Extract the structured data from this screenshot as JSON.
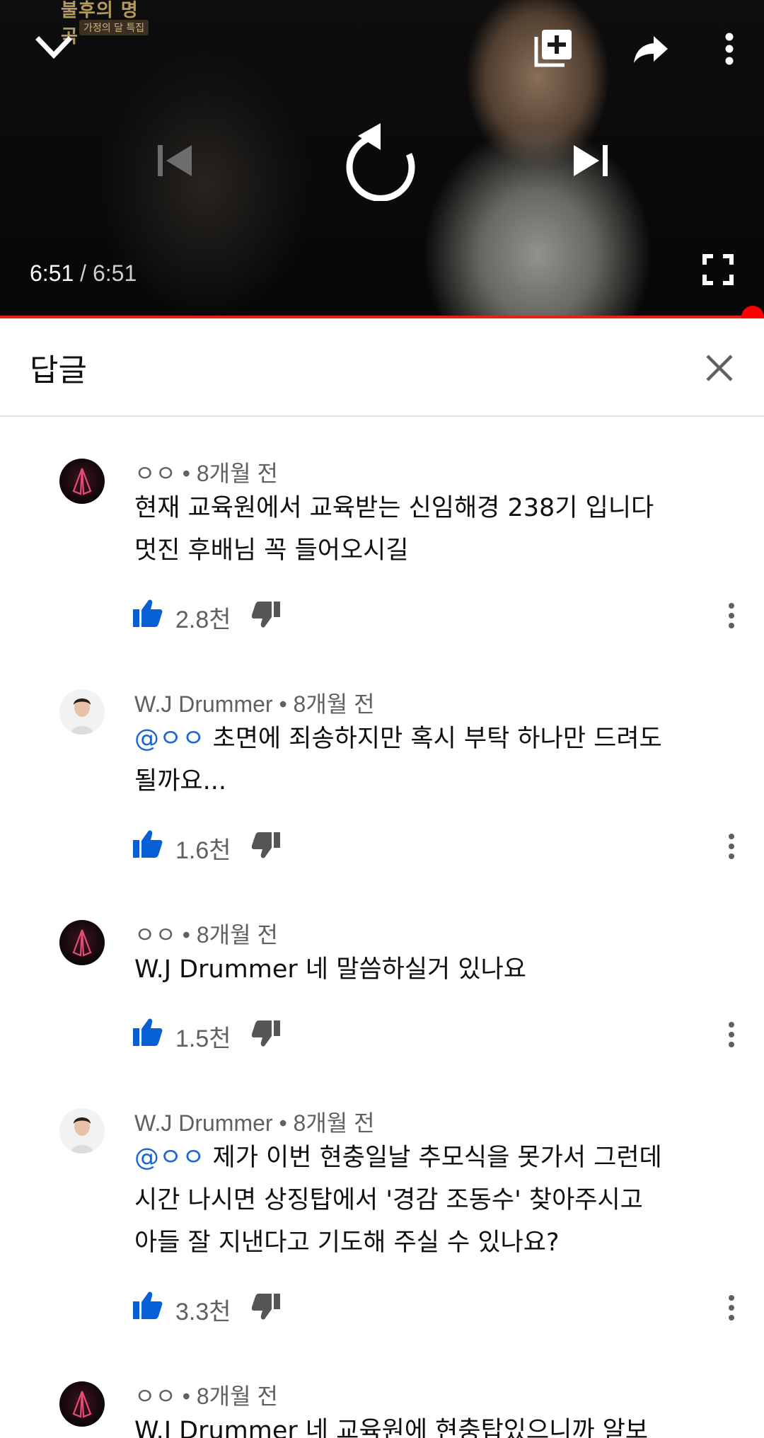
{
  "player": {
    "show_logo_text": "불후의 명곡",
    "show_logo_tag": "가정의 달 특집",
    "current_time": "6:51",
    "separator": "/",
    "duration": "6:51",
    "progress_fraction": 1.0,
    "icons": {
      "collapse": "chevron-down-icon",
      "add_to_queue": "add-to-queue-icon",
      "share": "share-icon",
      "more": "more-vert-icon",
      "previous": "skip-previous-icon",
      "replay": "replay-icon",
      "next": "skip-next-icon",
      "fullscreen": "fullscreen-icon"
    },
    "colors": {
      "progress": "#e62117",
      "scrubber": "#ff0000"
    }
  },
  "replies_panel": {
    "title": "답글",
    "close_icon": "close-icon"
  },
  "comments": [
    {
      "author": "ㅇㅇ",
      "age": "8개월 전",
      "avatar": "praying-hands-avatar",
      "mention": "",
      "text_lines": [
        "현재 교육원에서 교육받는 신임해경 238기 입니다",
        "멋진 후배님 꼭 들어오시길"
      ],
      "likes": "2.8천",
      "liked": true
    },
    {
      "author": "W.J Drummer",
      "age": "8개월 전",
      "avatar": "person-avatar",
      "mention": "@ㅇㅇ",
      "text_lines": [
        " 초면에 죄송하지만 혹시 부탁 하나만 드려도",
        "될까요..."
      ],
      "likes": "1.6천",
      "liked": true
    },
    {
      "author": "ㅇㅇ",
      "age": "8개월 전",
      "avatar": "praying-hands-avatar",
      "mention": "",
      "text_lines": [
        "W.J Drummer 네 말씀하실거 있나요"
      ],
      "likes": "1.5천",
      "liked": true
    },
    {
      "author": "W.J Drummer",
      "age": "8개월 전",
      "avatar": "person-avatar",
      "mention": "@ㅇㅇ",
      "text_lines": [
        " 제가 이번 현충일날 추모식을 못가서 그런데",
        "시간 나시면 상징탑에서 '경감 조동수' 찾아주시고",
        "아들 잘 지낸다고 기도해 주실 수 있나요?"
      ],
      "likes": "3.3천",
      "liked": true
    },
    {
      "author": "ㅇㅇ",
      "age": "8개월 전",
      "avatar": "praying-hands-avatar",
      "mention": "",
      "text_lines": [
        "W.J Drummer 네 교육원에 현충탑있으니까 알보"
      ],
      "likes": "",
      "liked": false
    }
  ],
  "ui_colors": {
    "like_blue": "#065fd4",
    "mention_blue": "#1a66d8",
    "meta_gray": "#606060"
  },
  "meta_separator": "•"
}
